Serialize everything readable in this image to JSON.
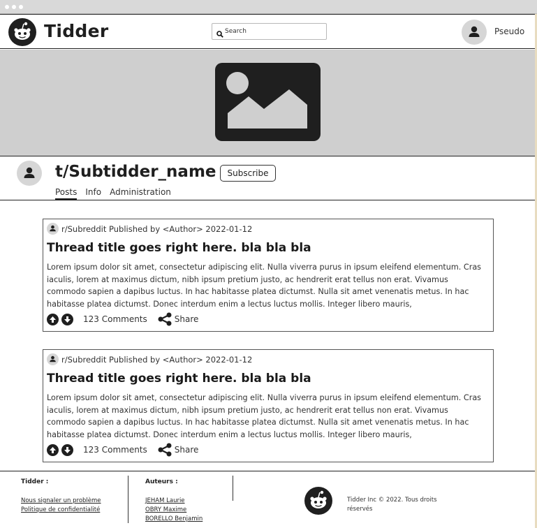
{
  "header": {
    "app_title": "Tidder",
    "search_placeholder": "Search",
    "username": "Pseudo"
  },
  "subreddit": {
    "name": "t/Subtidder_name",
    "subscribe_label": "Subscribe",
    "tabs": [
      {
        "label": "Posts",
        "active": true
      },
      {
        "label": "Info",
        "active": false
      },
      {
        "label": "Administration",
        "active": false
      }
    ]
  },
  "posts": [
    {
      "meta": "r/Subreddit Published by <Author> 2022-01-12",
      "title": "Thread title goes right here. bla bla bla",
      "body": "Lorem ipsum dolor sit amet, consectetur adipiscing elit. Nulla viverra purus in ipsum eleifend elementum. Cras iaculis, lorem at maximus  dictum, nibh ipsum pretium justo, ac hendrerit erat tellus non erat.  Vivamus commodo sapien a dapibus luctus. In hac habitasse platea  dictumst. Nulla sit amet venenatis metus. In hac habitasse platea  dictumst. Donec interdum enim a lectus luctus mollis. Integer libero  mauris,",
      "comments": "123 Comments",
      "share": "Share"
    },
    {
      "meta": "r/Subreddit Published by <Author> 2022-01-12",
      "title": "Thread title goes right here. bla bla bla",
      "body": "Lorem ipsum dolor sit amet, consectetur adipiscing elit. Nulla viverra purus in ipsum eleifend elementum. Cras iaculis, lorem at maximus  dictum, nibh ipsum pretium justo, ac hendrerit erat tellus non erat.  Vivamus commodo sapien a dapibus luctus. In hac habitasse platea  dictumst. Nulla sit amet venenatis metus. In hac habitasse platea  dictumst. Donec interdum enim a lectus luctus mollis. Integer libero  mauris,",
      "comments": "123 Comments",
      "share": "Share"
    }
  ],
  "footer": {
    "tidder_title": "Tidder :",
    "tidder_links": [
      "Nous signaler un problème",
      "Politique de confidentialité"
    ],
    "authors_title": "Auteurs :",
    "authors": [
      "JEHAM Laurie",
      "OBRY Maxime",
      "BORELLO Benjamin"
    ],
    "copyright": "Tidder Inc © 2022. Tous droits réservés"
  },
  "icons": {
    "logo": "alien-logo-icon",
    "search": "search-icon",
    "avatar": "user-icon",
    "banner": "image-placeholder-icon",
    "upvote": "arrow-up-circle-icon",
    "downvote": "arrow-down-circle-icon",
    "share": "share-icon"
  },
  "colors": {
    "dark": "#1f1f1f",
    "banner_bg": "#cfcfcf",
    "avatar_bg": "#d6d6d6"
  }
}
